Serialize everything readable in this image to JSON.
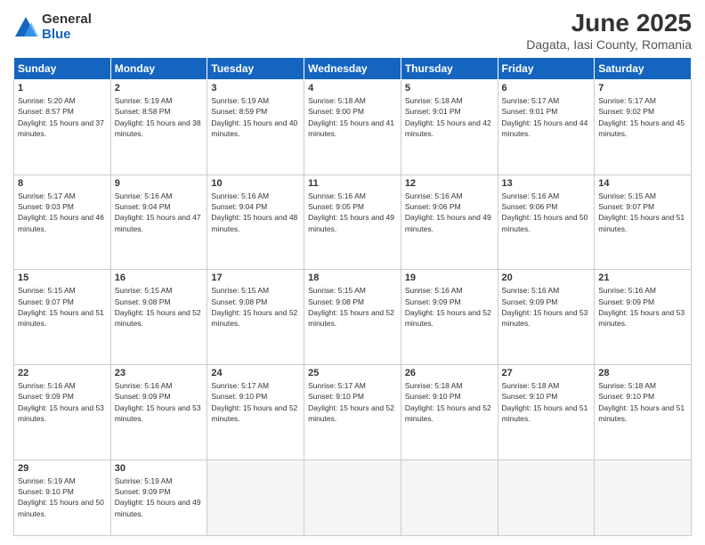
{
  "header": {
    "logo_general": "General",
    "logo_blue": "Blue",
    "title": "June 2025",
    "subtitle": "Dagata, Iasi County, Romania"
  },
  "weekdays": [
    "Sunday",
    "Monday",
    "Tuesday",
    "Wednesday",
    "Thursday",
    "Friday",
    "Saturday"
  ],
  "weeks": [
    [
      {
        "day": "1",
        "sunrise": "Sunrise: 5:20 AM",
        "sunset": "Sunset: 8:57 PM",
        "daylight": "Daylight: 15 hours and 37 minutes."
      },
      {
        "day": "2",
        "sunrise": "Sunrise: 5:19 AM",
        "sunset": "Sunset: 8:58 PM",
        "daylight": "Daylight: 15 hours and 38 minutes."
      },
      {
        "day": "3",
        "sunrise": "Sunrise: 5:19 AM",
        "sunset": "Sunset: 8:59 PM",
        "daylight": "Daylight: 15 hours and 40 minutes."
      },
      {
        "day": "4",
        "sunrise": "Sunrise: 5:18 AM",
        "sunset": "Sunset: 9:00 PM",
        "daylight": "Daylight: 15 hours and 41 minutes."
      },
      {
        "day": "5",
        "sunrise": "Sunrise: 5:18 AM",
        "sunset": "Sunset: 9:01 PM",
        "daylight": "Daylight: 15 hours and 42 minutes."
      },
      {
        "day": "6",
        "sunrise": "Sunrise: 5:17 AM",
        "sunset": "Sunset: 9:01 PM",
        "daylight": "Daylight: 15 hours and 44 minutes."
      },
      {
        "day": "7",
        "sunrise": "Sunrise: 5:17 AM",
        "sunset": "Sunset: 9:02 PM",
        "daylight": "Daylight: 15 hours and 45 minutes."
      }
    ],
    [
      {
        "day": "8",
        "sunrise": "Sunrise: 5:17 AM",
        "sunset": "Sunset: 9:03 PM",
        "daylight": "Daylight: 15 hours and 46 minutes."
      },
      {
        "day": "9",
        "sunrise": "Sunrise: 5:16 AM",
        "sunset": "Sunset: 9:04 PM",
        "daylight": "Daylight: 15 hours and 47 minutes."
      },
      {
        "day": "10",
        "sunrise": "Sunrise: 5:16 AM",
        "sunset": "Sunset: 9:04 PM",
        "daylight": "Daylight: 15 hours and 48 minutes."
      },
      {
        "day": "11",
        "sunrise": "Sunrise: 5:16 AM",
        "sunset": "Sunset: 9:05 PM",
        "daylight": "Daylight: 15 hours and 49 minutes."
      },
      {
        "day": "12",
        "sunrise": "Sunrise: 5:16 AM",
        "sunset": "Sunset: 9:06 PM",
        "daylight": "Daylight: 15 hours and 49 minutes."
      },
      {
        "day": "13",
        "sunrise": "Sunrise: 5:16 AM",
        "sunset": "Sunset: 9:06 PM",
        "daylight": "Daylight: 15 hours and 50 minutes."
      },
      {
        "day": "14",
        "sunrise": "Sunrise: 5:15 AM",
        "sunset": "Sunset: 9:07 PM",
        "daylight": "Daylight: 15 hours and 51 minutes."
      }
    ],
    [
      {
        "day": "15",
        "sunrise": "Sunrise: 5:15 AM",
        "sunset": "Sunset: 9:07 PM",
        "daylight": "Daylight: 15 hours and 51 minutes."
      },
      {
        "day": "16",
        "sunrise": "Sunrise: 5:15 AM",
        "sunset": "Sunset: 9:08 PM",
        "daylight": "Daylight: 15 hours and 52 minutes."
      },
      {
        "day": "17",
        "sunrise": "Sunrise: 5:15 AM",
        "sunset": "Sunset: 9:08 PM",
        "daylight": "Daylight: 15 hours and 52 minutes."
      },
      {
        "day": "18",
        "sunrise": "Sunrise: 5:15 AM",
        "sunset": "Sunset: 9:08 PM",
        "daylight": "Daylight: 15 hours and 52 minutes."
      },
      {
        "day": "19",
        "sunrise": "Sunrise: 5:16 AM",
        "sunset": "Sunset: 9:09 PM",
        "daylight": "Daylight: 15 hours and 52 minutes."
      },
      {
        "day": "20",
        "sunrise": "Sunrise: 5:16 AM",
        "sunset": "Sunset: 9:09 PM",
        "daylight": "Daylight: 15 hours and 53 minutes."
      },
      {
        "day": "21",
        "sunrise": "Sunrise: 5:16 AM",
        "sunset": "Sunset: 9:09 PM",
        "daylight": "Daylight: 15 hours and 53 minutes."
      }
    ],
    [
      {
        "day": "22",
        "sunrise": "Sunrise: 5:16 AM",
        "sunset": "Sunset: 9:09 PM",
        "daylight": "Daylight: 15 hours and 53 minutes."
      },
      {
        "day": "23",
        "sunrise": "Sunrise: 5:16 AM",
        "sunset": "Sunset: 9:09 PM",
        "daylight": "Daylight: 15 hours and 53 minutes."
      },
      {
        "day": "24",
        "sunrise": "Sunrise: 5:17 AM",
        "sunset": "Sunset: 9:10 PM",
        "daylight": "Daylight: 15 hours and 52 minutes."
      },
      {
        "day": "25",
        "sunrise": "Sunrise: 5:17 AM",
        "sunset": "Sunset: 9:10 PM",
        "daylight": "Daylight: 15 hours and 52 minutes."
      },
      {
        "day": "26",
        "sunrise": "Sunrise: 5:18 AM",
        "sunset": "Sunset: 9:10 PM",
        "daylight": "Daylight: 15 hours and 52 minutes."
      },
      {
        "day": "27",
        "sunrise": "Sunrise: 5:18 AM",
        "sunset": "Sunset: 9:10 PM",
        "daylight": "Daylight: 15 hours and 51 minutes."
      },
      {
        "day": "28",
        "sunrise": "Sunrise: 5:18 AM",
        "sunset": "Sunset: 9:10 PM",
        "daylight": "Daylight: 15 hours and 51 minutes."
      }
    ],
    [
      {
        "day": "29",
        "sunrise": "Sunrise: 5:19 AM",
        "sunset": "Sunset: 9:10 PM",
        "daylight": "Daylight: 15 hours and 50 minutes."
      },
      {
        "day": "30",
        "sunrise": "Sunrise: 5:19 AM",
        "sunset": "Sunset: 9:09 PM",
        "daylight": "Daylight: 15 hours and 49 minutes."
      },
      null,
      null,
      null,
      null,
      null
    ]
  ]
}
